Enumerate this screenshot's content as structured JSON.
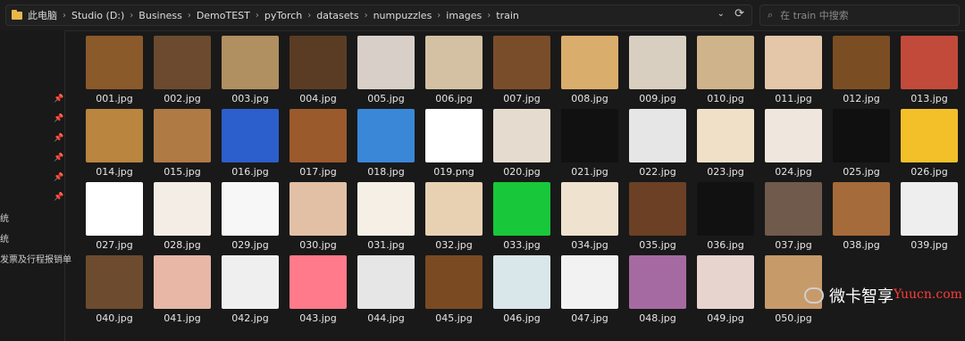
{
  "address_bar": {
    "breadcrumbs": [
      "此电脑",
      "Studio (D:)",
      "Business",
      "DemoTEST",
      "pyTorch",
      "datasets",
      "numpuzzles",
      "images",
      "train"
    ],
    "search_placeholder": "在 train 中搜索"
  },
  "sidebar": {
    "items": [
      "统",
      "统",
      "发票及行程报销单"
    ]
  },
  "files": [
    {
      "name": "001.jpg",
      "color": "#8a5a2b"
    },
    {
      "name": "002.jpg",
      "color": "#6b4a2f"
    },
    {
      "name": "003.jpg",
      "color": "#b08f61"
    },
    {
      "name": "004.jpg",
      "color": "#5a3c24"
    },
    {
      "name": "005.jpg",
      "color": "#d8cfc8"
    },
    {
      "name": "006.jpg",
      "color": "#d4c1a4"
    },
    {
      "name": "007.jpg",
      "color": "#7a4d2a"
    },
    {
      "name": "008.jpg",
      "color": "#d9ad6b"
    },
    {
      "name": "009.jpg",
      "color": "#d8cfc0"
    },
    {
      "name": "010.jpg",
      "color": "#cfb38a"
    },
    {
      "name": "011.jpg",
      "color": "#e4c6a9"
    },
    {
      "name": "012.jpg",
      "color": "#7b4d22"
    },
    {
      "name": "013.jpg",
      "color": "#c24a3a"
    },
    {
      "name": "014.jpg",
      "color": "#b9853f"
    },
    {
      "name": "015.jpg",
      "color": "#b07a45"
    },
    {
      "name": "016.jpg",
      "color": "#2d5fcc"
    },
    {
      "name": "017.jpg",
      "color": "#9b5a2c"
    },
    {
      "name": "018.jpg",
      "color": "#3a87d8"
    },
    {
      "name": "019.png",
      "color": "#ffffff"
    },
    {
      "name": "020.jpg",
      "color": "#e6dbcf"
    },
    {
      "name": "021.jpg",
      "color": "#111111"
    },
    {
      "name": "022.jpg",
      "color": "#e6e6e6"
    },
    {
      "name": "023.jpg",
      "color": "#f0e0c8"
    },
    {
      "name": "024.jpg",
      "color": "#efe7dd"
    },
    {
      "name": "025.jpg",
      "color": "#101010"
    },
    {
      "name": "026.jpg",
      "color": "#f3c02a"
    },
    {
      "name": "027.jpg",
      "color": "#ffffff"
    },
    {
      "name": "028.jpg",
      "color": "#f4ede6"
    },
    {
      "name": "029.jpg",
      "color": "#f7f7f7"
    },
    {
      "name": "030.jpg",
      "color": "#e2c0a5"
    },
    {
      "name": "031.jpg",
      "color": "#f6efe6"
    },
    {
      "name": "032.jpg",
      "color": "#e8d1b3"
    },
    {
      "name": "033.jpg",
      "color": "#18c83a"
    },
    {
      "name": "034.jpg",
      "color": "#efe3d0"
    },
    {
      "name": "035.jpg",
      "color": "#6b4024"
    },
    {
      "name": "036.jpg",
      "color": "#111111"
    },
    {
      "name": "037.jpg",
      "color": "#6f5a4c"
    },
    {
      "name": "038.jpg",
      "color": "#a56b3a"
    },
    {
      "name": "039.jpg",
      "color": "#eeeeee"
    },
    {
      "name": "040.jpg",
      "color": "#6d4b2e"
    },
    {
      "name": "041.jpg",
      "color": "#e8b7a6"
    },
    {
      "name": "042.jpg",
      "color": "#efefef"
    },
    {
      "name": "043.jpg",
      "color": "#ff7a8a"
    },
    {
      "name": "044.jpg",
      "color": "#e6e6e6"
    },
    {
      "name": "045.jpg",
      "color": "#7a4a22"
    },
    {
      "name": "046.jpg",
      "color": "#d9e7ea"
    },
    {
      "name": "047.jpg",
      "color": "#f2f2f2"
    },
    {
      "name": "048.jpg",
      "color": "#a56aa2"
    },
    {
      "name": "049.jpg",
      "color": "#e7d4cf"
    },
    {
      "name": "050.jpg",
      "color": "#c79a6a"
    }
  ],
  "watermark": {
    "text": "微卡智享",
    "sub": "Yuucn.com"
  }
}
